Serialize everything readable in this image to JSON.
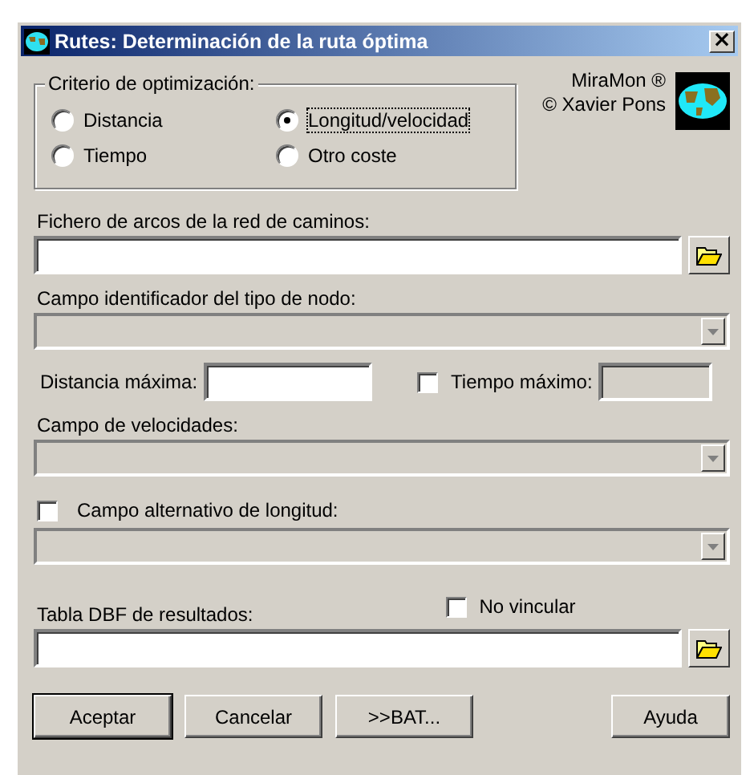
{
  "window": {
    "title": "Rutes: Determinación de la ruta óptima",
    "close": "×"
  },
  "criteria": {
    "label": "Criterio de optimización:",
    "options": [
      {
        "label": "Distancia",
        "selected": false
      },
      {
        "label": "Longitud/velocidad",
        "selected": true
      },
      {
        "label": "Tiempo",
        "selected": false
      },
      {
        "label": "Otro coste",
        "selected": false
      }
    ]
  },
  "credits": [
    "MiraMon ®",
    "© Xavier Pons"
  ],
  "arcs_file": {
    "label": "Fichero de arcos de la red de caminos:"
  },
  "node_field": {
    "label": "Campo identificador del tipo de nodo:",
    "disabled": true
  },
  "max_distance": {
    "label": "Distancia máxima:"
  },
  "max_time": {
    "label": "Tiempo máximo:",
    "checked": false,
    "disabled": true
  },
  "speed_field": {
    "label": "Campo de velocidades:",
    "disabled": true
  },
  "alt_length": {
    "label": "Campo alternativo de longitud:",
    "checked": false,
    "disabled": true
  },
  "results": {
    "label": "Tabla DBF de resultados:",
    "no_link": {
      "label": "No vincular",
      "checked": false
    }
  },
  "buttons": [
    {
      "label": "Aceptar",
      "default": true
    },
    {
      "label": "Cancelar",
      "default": false
    },
    {
      "label": ">>BAT...",
      "default": false
    },
    {
      "label": "Ayuda",
      "default": false
    }
  ]
}
